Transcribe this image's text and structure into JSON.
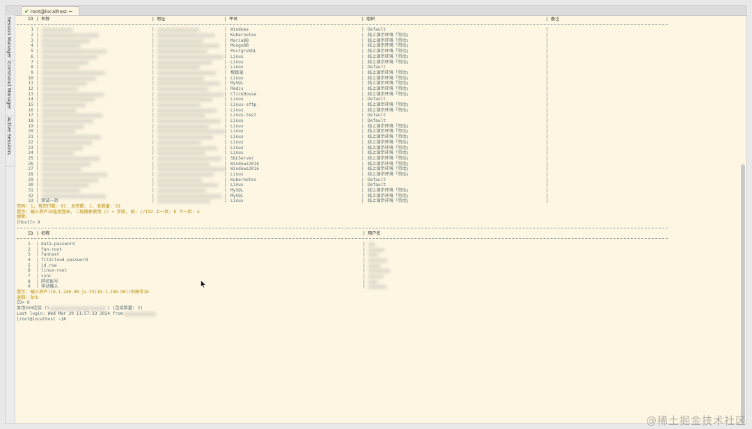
{
  "tab": {
    "title": "root@localhost:~",
    "status_icon": "check-icon"
  },
  "sidebar": [
    {
      "label": "Session Manager"
    },
    {
      "label": "Command Manager"
    },
    {
      "label": "Active Sessions"
    }
  ],
  "assets": {
    "headers": {
      "id": "ID",
      "name": "名称",
      "address": "地址",
      "platform": "平台",
      "org": "组织",
      "comment": "备注"
    },
    "rows": [
      {
        "id": "1",
        "name": "",
        "platform": "Windows",
        "org": "Default"
      },
      {
        "id": "2",
        "name": "",
        "platform": "Kubernetes",
        "org": "线上演示环境「勿动」"
      },
      {
        "id": "3",
        "name": "",
        "platform": "MariaDB",
        "org": "线上演示环境「勿动」"
      },
      {
        "id": "4",
        "name": "",
        "platform": "MongoDB",
        "org": "线上演示环境「勿动」"
      },
      {
        "id": "5",
        "name": "",
        "platform": "PostgreSQL",
        "org": "线上演示环境「勿动」"
      },
      {
        "id": "6",
        "name": "",
        "platform": "Linux",
        "org": "线上演示环境「勿动」"
      },
      {
        "id": "7",
        "name": "",
        "platform": "Linux",
        "org": "线上演示环境「勿动」"
      },
      {
        "id": "8",
        "name": "",
        "platform": "Linux",
        "org": "Default"
      },
      {
        "id": "9",
        "name": "",
        "platform": "根目录",
        "org": "线上演示环境「勿动」"
      },
      {
        "id": "10",
        "name": "",
        "platform": "Linux",
        "org": "线上演示环境「勿动」"
      },
      {
        "id": "11",
        "name": "",
        "platform": "MySQL",
        "org": "线上演示环境「勿动」"
      },
      {
        "id": "12",
        "name": "",
        "platform": "Redis",
        "org": "线上演示环境「勿动」"
      },
      {
        "id": "13",
        "name": "",
        "platform": "ClickHouse",
        "org": "线上演示环境「勿动」"
      },
      {
        "id": "14",
        "name": "",
        "platform": "Linux",
        "org": "Default"
      },
      {
        "id": "15",
        "name": "",
        "platform": "Linux-sftp",
        "org": "线上演示环境「勿动」"
      },
      {
        "id": "16",
        "name": "",
        "platform": "Linux",
        "org": "线上演示环境「勿动」"
      },
      {
        "id": "17",
        "name": "",
        "platform": "Linux-test",
        "org": "Default"
      },
      {
        "id": "18",
        "name": "",
        "platform": "Linux",
        "org": "Default"
      },
      {
        "id": "19",
        "name": "",
        "platform": "Linux",
        "org": "线上演示环境「勿动」"
      },
      {
        "id": "20",
        "name": "",
        "platform": "Linux",
        "org": "线上演示环境「勿动」"
      },
      {
        "id": "21",
        "name": "",
        "platform": "Linux",
        "org": "线上演示环境「勿动」"
      },
      {
        "id": "22",
        "name": "",
        "platform": "Linux",
        "org": "线上演示环境「勿动」"
      },
      {
        "id": "23",
        "name": "",
        "platform": "Linux",
        "org": "线上演示环境「勿动」"
      },
      {
        "id": "24",
        "name": "",
        "platform": "Linux",
        "org": "线上演示环境「勿动」"
      },
      {
        "id": "25",
        "name": "",
        "platform": "SQLServer",
        "org": "线上演示环境「勿动」"
      },
      {
        "id": "26",
        "name": "",
        "platform": "Windows2016",
        "org": "线上演示环境「勿动」"
      },
      {
        "id": "27",
        "name": "",
        "platform": "Windows2016",
        "org": "线上演示环境「勿动」"
      },
      {
        "id": "28",
        "name": "",
        "platform": "Linux",
        "org": "线上演示环境「勿动」"
      },
      {
        "id": "29",
        "name": "",
        "platform": "Kubernetes",
        "org": "Default"
      },
      {
        "id": "30",
        "name": "",
        "platform": "Linux",
        "org": "Default"
      },
      {
        "id": "31",
        "name": "",
        "platform": "MySQL",
        "org": "线上演示环境「勿动」"
      },
      {
        "id": "32",
        "name": "",
        "platform": "MySQL",
        "org": "线上演示环境「勿动」"
      },
      {
        "id": "33",
        "name": "测试一恐",
        "platform": "Linux",
        "org": "线上演示环境「勿动」"
      }
    ]
  },
  "pager_line": "页码: 1, 每页行数: 67, 总页数: 1, 总数量: 33",
  "hint_line": "提示: 输入资产ID直接登录, 二级搜索使用 // + 字段, 如: //192 上一页: b 下一页: n",
  "search_line": "搜索:",
  "prompt_host": "[Host]> 9",
  "accounts": {
    "headers": {
      "id": "ID",
      "name": "名称",
      "username": "用户名"
    },
    "rows": [
      {
        "id": "1",
        "name": "data-password"
      },
      {
        "id": "2",
        "name": "fan-root"
      },
      {
        "id": "3",
        "name": "fantest"
      },
      {
        "id": "4",
        "name": "fit2cloud-password"
      },
      {
        "id": "5",
        "name": "id_rsa"
      },
      {
        "id": "6",
        "name": "linux-root"
      },
      {
        "id": "7",
        "name": "sync"
      },
      {
        "id": "8",
        "name": "同名账号"
      },
      {
        "id": "9",
        "name": "手动输入"
      }
    ]
  },
  "account_hint": "提示: 输入资产(10.1.240.90-js-V3(10.1.240.90))的账号ID",
  "back_hint": "返回: B/b",
  "id_prompt": "ID> 6",
  "ssh_line_prefix": "复用SSH连接 (l",
  "ssh_line_suffix": ") [连接数量: 3]",
  "last_login": "Last login: Wed Mar 20 11:57:33 2024 from",
  "shell_prompt": "[root@localhost ~]#",
  "watermark": "@稀土掘金技术社区",
  "colors": {
    "terminal_bg": "#fdf6e3",
    "text": "#586e75",
    "hint": "#b58900",
    "check": "#2a9d2a"
  }
}
